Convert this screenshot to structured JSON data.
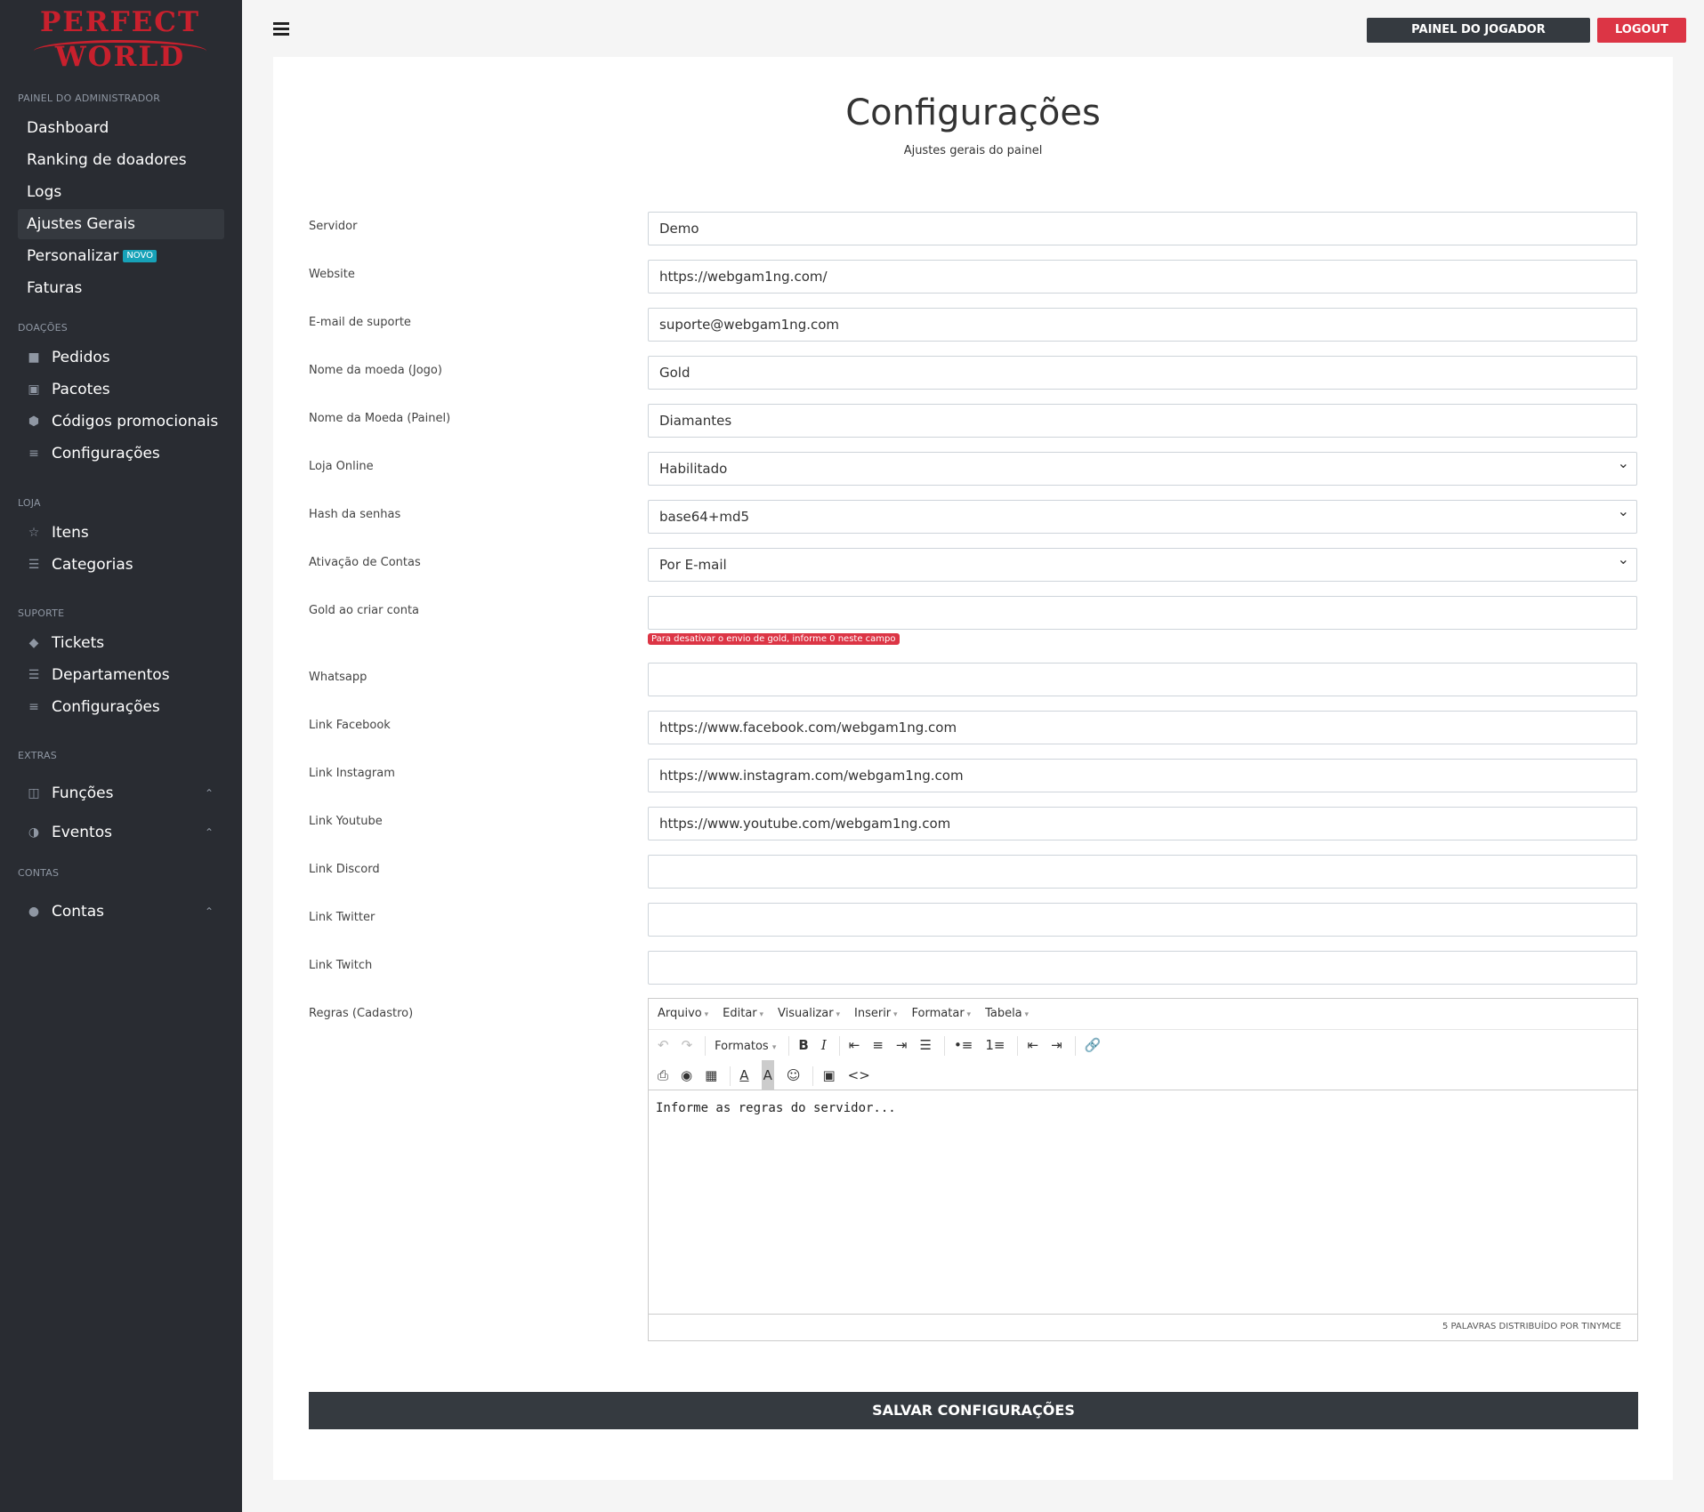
{
  "brand": {
    "line1": "PERFECT",
    "line2": "WORLD",
    "color": "#c8202d"
  },
  "sidebar": {
    "section_admin": "PAINEL DO ADMINISTRADOR",
    "admin_items": [
      {
        "label": "Dashboard"
      },
      {
        "label": "Ranking de doadores"
      },
      {
        "label": "Logs"
      },
      {
        "label": "Ajustes Gerais",
        "active": true
      },
      {
        "label": "Personalizar",
        "badge": "NOVO"
      },
      {
        "label": "Faturas"
      }
    ],
    "section_doacoes": "DOAÇÕES",
    "doacoes_items": [
      {
        "label": "Pedidos",
        "icon": "file-icon"
      },
      {
        "label": "Pacotes",
        "icon": "archive-icon"
      },
      {
        "label": "Códigos promocionais",
        "icon": "cube-icon"
      },
      {
        "label": "Configurações",
        "icon": "sliders-icon"
      }
    ],
    "section_loja": "LOJA",
    "loja_items": [
      {
        "label": "Itens",
        "icon": "star-icon"
      },
      {
        "label": "Categorias",
        "icon": "list-icon"
      }
    ],
    "section_suporte": "SUPORTE",
    "suporte_items": [
      {
        "label": "Tickets",
        "icon": "tag-icon"
      },
      {
        "label": "Departamentos",
        "icon": "list-icon"
      },
      {
        "label": "Configurações",
        "icon": "sliders-icon"
      }
    ],
    "section_extras": "EXTRAS",
    "extras_items": [
      {
        "label": "Funções",
        "icon": "sitemap-icon"
      },
      {
        "label": "Eventos",
        "icon": "palette-icon"
      }
    ],
    "section_contas": "CONTAS",
    "contas_items": [
      {
        "label": "Contas",
        "icon": "users-icon"
      }
    ]
  },
  "topbar": {
    "player_panel": "PAINEL DO JOGADOR",
    "logout": "LOGOUT"
  },
  "page": {
    "title": "Configurações",
    "subtitle": "Ajustes gerais do painel"
  },
  "form": {
    "servidor": {
      "label": "Servidor",
      "value": "Demo"
    },
    "website": {
      "label": "Website",
      "value": "https://webgam1ng.com/"
    },
    "email": {
      "label": "E-mail de suporte",
      "value": "suporte@webgam1ng.com"
    },
    "moeda_jogo": {
      "label": "Nome da moeda (Jogo)",
      "value": "Gold"
    },
    "moeda_painel": {
      "label": "Nome da Moeda (Painel)",
      "value": "Diamantes"
    },
    "loja_online": {
      "label": "Loja Online",
      "value": "Habilitado"
    },
    "hash": {
      "label": "Hash da senhas",
      "value": "base64+md5"
    },
    "ativacao": {
      "label": "Ativação de Contas",
      "value": "Por E-mail"
    },
    "gold_criar": {
      "label": "Gold ao criar conta",
      "value": "",
      "help": "Para desativar o envio de gold, informe 0 neste campo"
    },
    "whatsapp": {
      "label": "Whatsapp",
      "value": ""
    },
    "facebook": {
      "label": "Link Facebook",
      "value": "https://www.facebook.com/webgam1ng.com"
    },
    "instagram": {
      "label": "Link Instagram",
      "value": "https://www.instagram.com/webgam1ng.com"
    },
    "youtube": {
      "label": "Link Youtube",
      "value": "https://www.youtube.com/webgam1ng.com"
    },
    "discord": {
      "label": "Link Discord",
      "value": ""
    },
    "twitter": {
      "label": "Link Twitter",
      "value": ""
    },
    "twitch": {
      "label": "Link Twitch",
      "value": ""
    },
    "regras": {
      "label": "Regras (Cadastro)"
    }
  },
  "editor": {
    "menus": [
      "Arquivo",
      "Editar",
      "Visualizar",
      "Inserir",
      "Formatar",
      "Tabela"
    ],
    "formats_label": "Formatos",
    "content": "Informe as regras do servidor...",
    "status": "5 PALAVRAS DISTRIBUÍDO POR  TINYMCE"
  },
  "save_label": "SALVAR CONFIGURAÇÕES",
  "colors": {
    "sidebar_bg": "#292c32",
    "danger": "#dc3545",
    "dark_button": "#353a40",
    "info_badge": "#17a2b8"
  }
}
